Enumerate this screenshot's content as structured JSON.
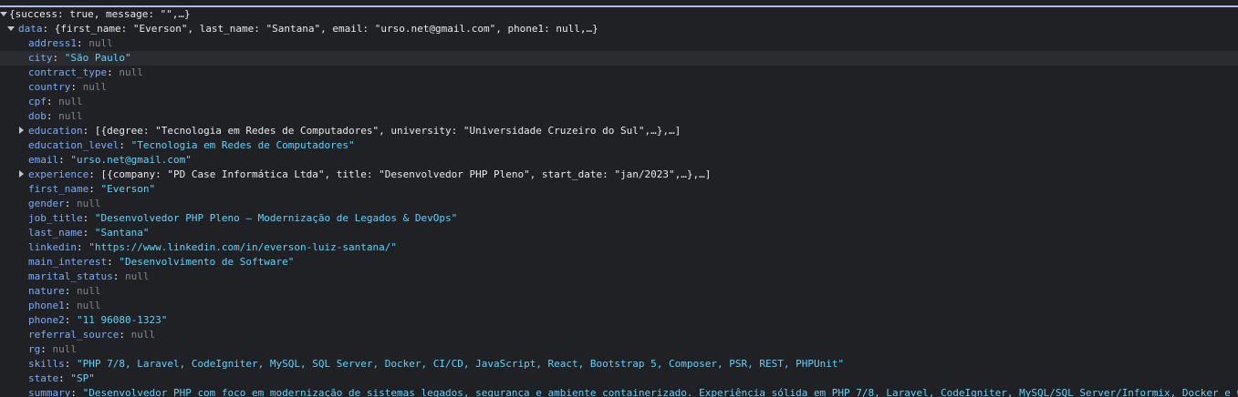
{
  "root": {
    "preview": "{success: true, message: \"\",…}"
  },
  "data_node": {
    "key": "data",
    "preview": "{first_name: \"Everson\", last_name: \"Santana\", email: \"urso.net@gmail.com\", phone1: null,…}"
  },
  "rows": [
    {
      "key": "address1",
      "value": "null",
      "type": "null"
    },
    {
      "key": "city",
      "value": "\"São Paulo\"",
      "type": "str"
    },
    {
      "key": "contract_type",
      "value": "null",
      "type": "null"
    },
    {
      "key": "country",
      "value": "null",
      "type": "null"
    },
    {
      "key": "cpf",
      "value": "null",
      "type": "null"
    },
    {
      "key": "dob",
      "value": "null",
      "type": "null"
    },
    {
      "key": "education",
      "value": "[{degree: \"Tecnologia em Redes de Computadores\", university: \"Universidade Cruzeiro do Sul\",…},…]",
      "type": "array"
    },
    {
      "key": "education_level",
      "value": "\"Tecnologia em Redes de Computadores\"",
      "type": "str"
    },
    {
      "key": "email",
      "value": "\"urso.net@gmail.com\"",
      "type": "str"
    },
    {
      "key": "experience",
      "value": "[{company: \"PD Case Informática Ltda\", title: \"Desenvolvedor PHP Pleno\", start_date: \"jan/2023\",…},…]",
      "type": "array"
    },
    {
      "key": "first_name",
      "value": "\"Everson\"",
      "type": "str"
    },
    {
      "key": "gender",
      "value": "null",
      "type": "null"
    },
    {
      "key": "job_title",
      "value": "\"Desenvolvedor PHP Pleno — Modernização de Legados & DevOps\"",
      "type": "str"
    },
    {
      "key": "last_name",
      "value": "\"Santana\"",
      "type": "str"
    },
    {
      "key": "linkedin",
      "value": "\"https://www.linkedin.com/in/everson-luiz-santana/\"",
      "type": "str"
    },
    {
      "key": "main_interest",
      "value": "\"Desenvolvimento de Software\"",
      "type": "str"
    },
    {
      "key": "marital_status",
      "value": "null",
      "type": "null"
    },
    {
      "key": "nature",
      "value": "null",
      "type": "null"
    },
    {
      "key": "phone1",
      "value": "null",
      "type": "null"
    },
    {
      "key": "phone2",
      "value": "\"11 96080-1323\"",
      "type": "str"
    },
    {
      "key": "referral_source",
      "value": "null",
      "type": "null"
    },
    {
      "key": "rg",
      "value": "null",
      "type": "null"
    },
    {
      "key": "skills",
      "value": "\"PHP 7/8, Laravel, CodeIgniter, MySQL, SQL Server, Docker, CI/CD, JavaScript, React, Bootstrap 5, Composer, PSR, REST, PHPUnit\"",
      "type": "str"
    },
    {
      "key": "state",
      "value": "\"SP\"",
      "type": "str"
    },
    {
      "key": "summary",
      "value": "\"Desenvolvedor PHP com foco em modernização de sistemas legados, segurança e ambiente containerizado. Experiência sólida em PHP 7/8, Laravel, CodeIgniter, MySQL/SQL Server/Informix, Docker e CI",
      "type": "str"
    }
  ],
  "colors": {
    "background": "#202124",
    "key": "#7cacf8",
    "string": "#5cd5fb",
    "null": "#80868b",
    "text": "#e8eaed",
    "highlight": "#2a2c30",
    "top_border": "#a9c0e8"
  }
}
